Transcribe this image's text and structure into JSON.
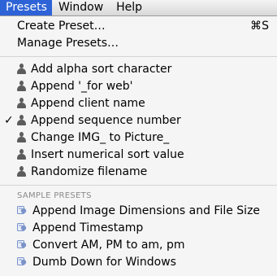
{
  "menubar": {
    "items": [
      {
        "label": "Presets",
        "active": true
      },
      {
        "label": "Window",
        "active": false
      },
      {
        "label": "Help",
        "active": false
      }
    ]
  },
  "menu": {
    "top_items": [
      {
        "label": "Create Preset…",
        "shortcut": "⌘S"
      },
      {
        "label": "Manage Presets…",
        "shortcut": ""
      }
    ],
    "user_presets": [
      {
        "label": "Add alpha sort character",
        "checked": false
      },
      {
        "label": "Append '_for web'",
        "checked": false
      },
      {
        "label": "Append client name",
        "checked": false
      },
      {
        "label": "Append sequence number",
        "checked": true
      },
      {
        "label": "Change IMG_ to Picture_",
        "checked": false
      },
      {
        "label": "Insert numerical sort value",
        "checked": false
      },
      {
        "label": "Randomize filename",
        "checked": false
      }
    ],
    "sample_header": "SAMPLE PRESETS",
    "sample_presets": [
      {
        "label": "Append Image Dimensions and File Size"
      },
      {
        "label": "Append Timestamp"
      },
      {
        "label": "Convert AM, PM to am, pm"
      },
      {
        "label": "Dumb Down for Windows"
      }
    ],
    "check_glyph": "✓"
  },
  "colors": {
    "accent": "#2d63d6",
    "icon_gray": "#5c5c5c",
    "sample_icon": "#7b93c9"
  },
  "icons": {
    "user_preset": "person-icon",
    "sample_preset": "sample-preset-icon",
    "check": "checkmark-icon"
  }
}
